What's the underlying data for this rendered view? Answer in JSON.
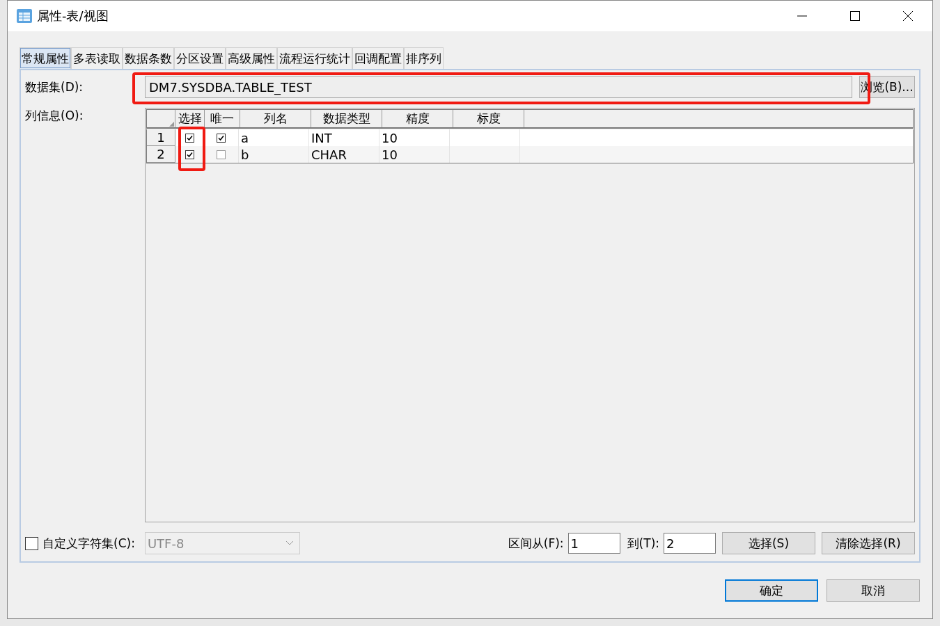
{
  "window": {
    "title": "属性-表/视图"
  },
  "tabs": [
    {
      "label": "常规属性",
      "selected": true
    },
    {
      "label": "多表读取",
      "selected": false
    },
    {
      "label": "数据条数",
      "selected": false
    },
    {
      "label": "分区设置",
      "selected": false
    },
    {
      "label": "高级属性",
      "selected": false
    },
    {
      "label": "流程运行统计",
      "selected": false
    },
    {
      "label": "回调配置",
      "selected": false
    },
    {
      "label": "排序列",
      "selected": false
    }
  ],
  "dataset": {
    "label": "数据集(D):",
    "value": "DM7.SYSDBA.TABLE_TEST",
    "highlighted": true,
    "browse_button": "浏览(B)..."
  },
  "columns_info": {
    "label": "列信息(O):"
  },
  "table": {
    "columns": [
      {
        "label": "选择",
        "kind": "check",
        "highlighted": true
      },
      {
        "label": "唯一",
        "kind": "check",
        "highlighted": false
      },
      {
        "label": "列名",
        "kind": "text",
        "highlighted": false
      },
      {
        "label": "数据类型",
        "kind": "text",
        "highlighted": false
      },
      {
        "label": "精度",
        "kind": "text",
        "highlighted": false
      },
      {
        "label": "标度",
        "kind": "text",
        "highlighted": false
      }
    ],
    "rows": [
      {
        "number": "1",
        "cells": [
          {
            "checked": true
          },
          {
            "checked": true
          },
          {
            "text": "a"
          },
          {
            "text": "INT"
          },
          {
            "text": "10"
          },
          {
            "text": ""
          }
        ]
      },
      {
        "number": "2",
        "cells": [
          {
            "checked": true
          },
          {
            "checked": false
          },
          {
            "text": "b"
          },
          {
            "text": "CHAR"
          },
          {
            "text": "10"
          },
          {
            "text": ""
          }
        ]
      }
    ]
  },
  "charset": {
    "label": "自定义字符集(C):",
    "checked": false,
    "value": "UTF-8",
    "disabled": true
  },
  "range": {
    "from_label": "区间从(F):",
    "from_value": "1",
    "to_label": "到(T):",
    "to_value": "2"
  },
  "buttons": {
    "select": "选择(S)",
    "clear": "清除选择(R)",
    "ok": "确定",
    "cancel": "取消"
  }
}
